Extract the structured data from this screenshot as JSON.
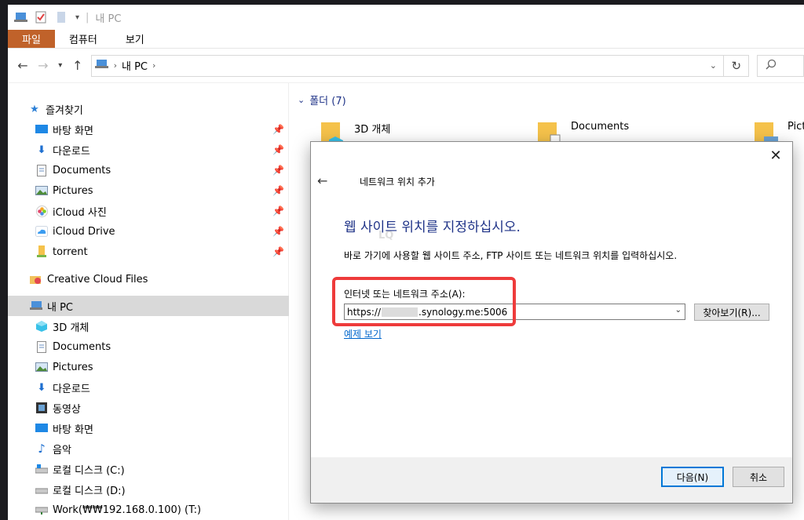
{
  "titlebar": {
    "title": "내 PC"
  },
  "ribbon": {
    "tabs": [
      "파일",
      "컴퓨터",
      "보기"
    ]
  },
  "address": {
    "location": "내 PC"
  },
  "navpane": {
    "quick_access": "즐겨찾기",
    "quick_items": [
      {
        "label": "바탕 화면",
        "icon": "desktop-icon"
      },
      {
        "label": "다운로드",
        "icon": "download-icon"
      },
      {
        "label": "Documents",
        "icon": "document-icon"
      },
      {
        "label": "Pictures",
        "icon": "pictures-icon"
      },
      {
        "label": "iCloud 사진",
        "icon": "icloud-photos-icon"
      },
      {
        "label": "iCloud Drive",
        "icon": "icloud-drive-icon"
      },
      {
        "label": "torrent",
        "icon": "folder-icon"
      }
    ],
    "creative_cloud": "Creative Cloud Files",
    "this_pc": "내 PC",
    "pc_items": [
      {
        "label": "3D 개체",
        "icon": "3d-objects-icon"
      },
      {
        "label": "Documents",
        "icon": "document-icon"
      },
      {
        "label": "Pictures",
        "icon": "pictures-icon"
      },
      {
        "label": "다운로드",
        "icon": "download-icon"
      },
      {
        "label": "동영상",
        "icon": "video-icon"
      },
      {
        "label": "바탕 화면",
        "icon": "desktop-icon"
      },
      {
        "label": "음악",
        "icon": "music-icon"
      },
      {
        "label": "로컬 디스크 (C:)",
        "icon": "drive-icon"
      },
      {
        "label": "로컬 디스크 (D:)",
        "icon": "drive-icon"
      },
      {
        "label": "Work(₩₩192.168.0.100) (T:)",
        "icon": "network-drive-icon"
      }
    ]
  },
  "content": {
    "group": "폴더 (7)",
    "folders": [
      "3D 개체",
      "Documents",
      "Pictu"
    ]
  },
  "dialog": {
    "title": "네트워크 위치 추가",
    "heading": "웹 사이트 위치를 지정하십시오.",
    "description": "바로 가기에 사용할 웹 사이트 주소, FTP 사이트 또는 네트워크 위치를 입력하십시오.",
    "address_label": "인터넷 또는 네트워크 주소(A):",
    "address_prefix": "https://",
    "address_suffix": ".synology.me:5006",
    "browse_label": "찾아보기(R)...",
    "example_link": "예제 보기",
    "next_label": "다음(N)",
    "cancel_label": "취소"
  },
  "colors": {
    "file_tab": "#c0622a",
    "heading": "#1e3287",
    "highlight": "#ee3b3b",
    "link": "#0066cc"
  }
}
